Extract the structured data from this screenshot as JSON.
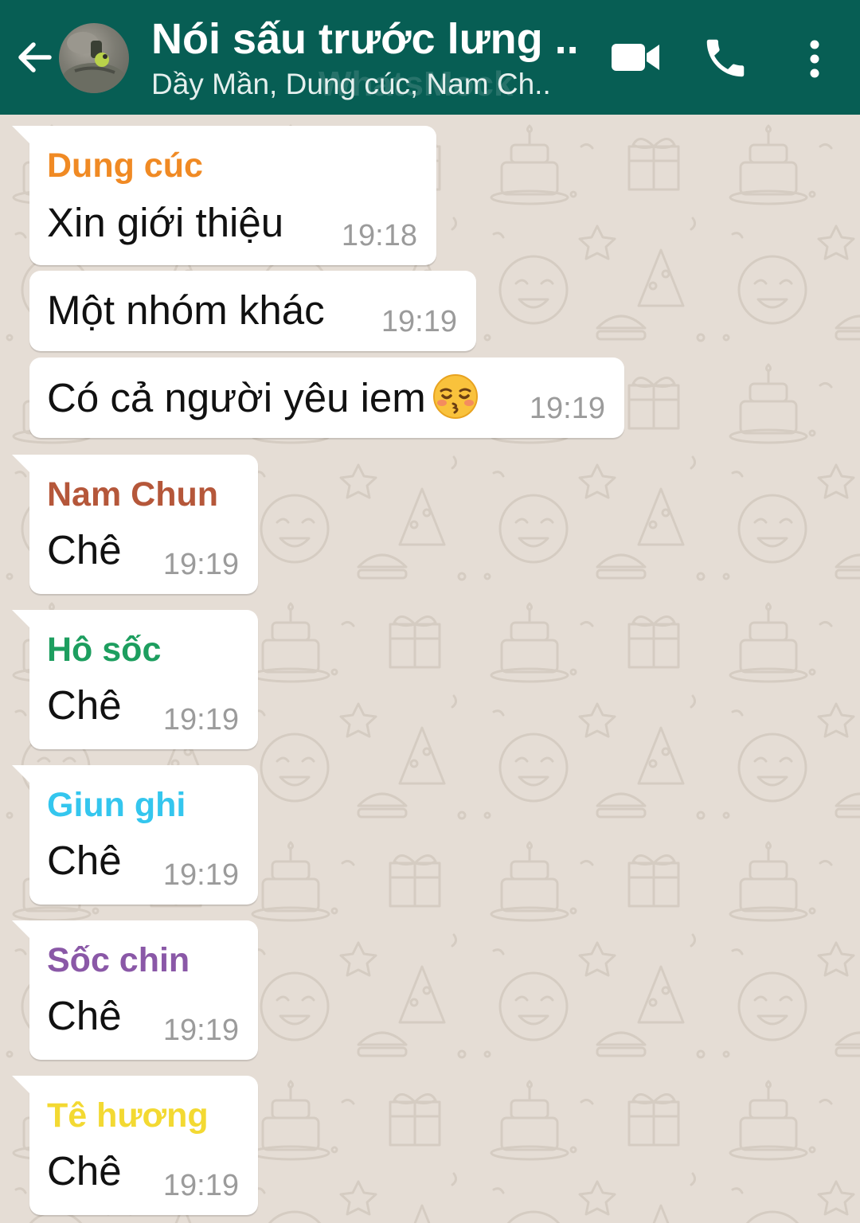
{
  "header": {
    "title": "Nói sấu trước lưng ...",
    "subtitle": "Dầy Mần, Dung cúc, Nam Ch..",
    "watermark": "WhatsMock",
    "icons": [
      "back-arrow-icon",
      "group-avatar",
      "video-call-icon",
      "voice-call-icon",
      "more-vert-icon"
    ]
  },
  "messages": [
    {
      "sender": "Dung cúc",
      "sender_color": "#f08a24",
      "text": "Xin giới thiệu",
      "time": "19:18"
    },
    {
      "text": "Một nhóm khác",
      "time": "19:19"
    },
    {
      "text": "Có cả người yêu iem",
      "emoji": "kissing-face-closed-eyes-icon",
      "time": "19:19"
    },
    {
      "sender": "Nam Chun",
      "sender_color": "#b5573a",
      "text": "Chê",
      "time": "19:19"
    },
    {
      "sender": "Hô sốc",
      "sender_color": "#1d9e5f",
      "text": "Chê",
      "time": "19:19"
    },
    {
      "sender": "Giun ghi",
      "sender_color": "#34c6ee",
      "text": "Chê",
      "time": "19:19"
    },
    {
      "sender": "Sốc chin",
      "sender_color": "#8a58a7",
      "text": "Chê",
      "time": "19:19"
    },
    {
      "sender": "Tê hương",
      "sender_color": "#f3d932",
      "text": "Chê",
      "time": "19:19"
    }
  ],
  "colors": {
    "header_bg": "#075e54",
    "chat_bg": "#e5ddd5",
    "bubble_bg": "#ffffff",
    "time_text": "#9b9b9b"
  }
}
